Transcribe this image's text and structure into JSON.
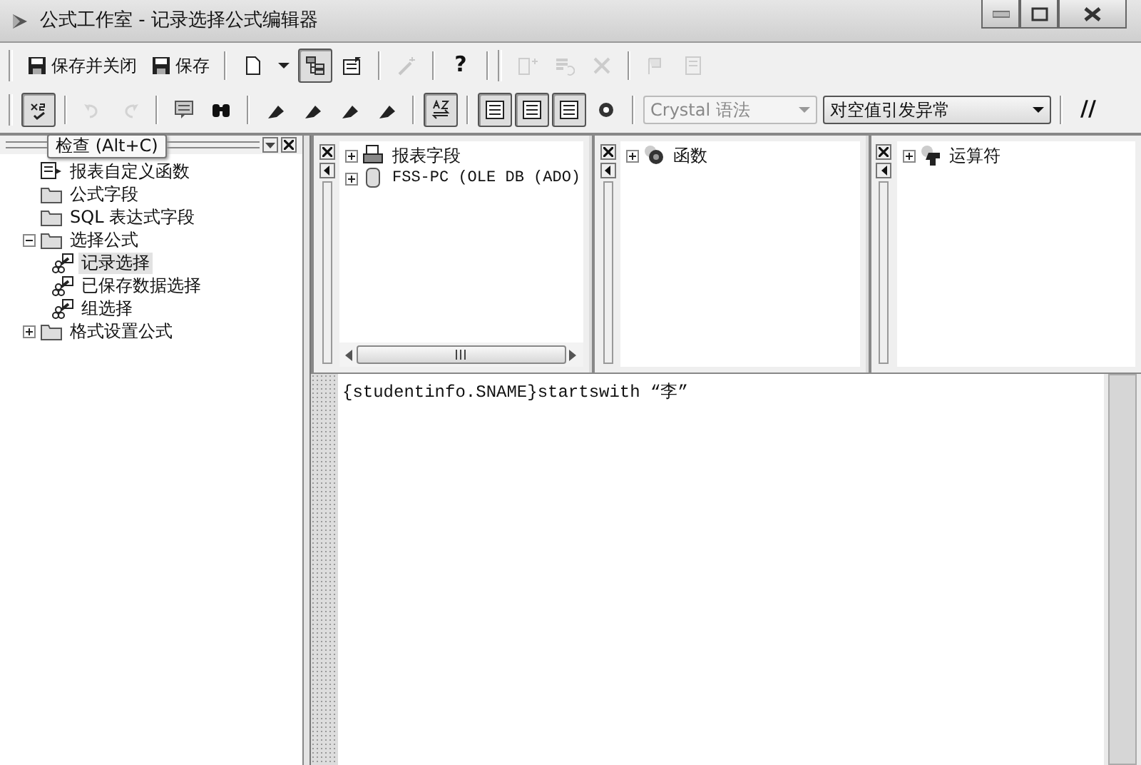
{
  "window": {
    "title": "公式工作室 - 记录选择公式编辑器"
  },
  "toolbar_1": {
    "groups": [
      [
        {
          "kind": "text",
          "label": "保存并关闭",
          "pressed": false,
          "disabled": false
        },
        {
          "kind": "text",
          "label": "保存",
          "pressed": false,
          "disabled": false
        }
      ],
      [
        {
          "kind": "icon",
          "pressed": false,
          "disabled": false
        },
        {
          "kind": "caret",
          "pressed": false,
          "disabled": false
        },
        {
          "kind": "icon",
          "pressed": true,
          "disabled": false
        },
        {
          "kind": "icon",
          "pressed": false,
          "disabled": false
        }
      ],
      [
        {
          "kind": "icon",
          "pressed": false,
          "disabled": true
        }
      ],
      [
        {
          "kind": "char",
          "label": "?",
          "pressed": false,
          "disabled": false
        }
      ],
      [
        {
          "kind": "icon",
          "pressed": false,
          "disabled": true
        },
        {
          "kind": "icon",
          "pressed": false,
          "disabled": true
        },
        {
          "kind": "icon",
          "pressed": false,
          "disabled": true
        }
      ],
      [
        {
          "kind": "icon",
          "pressed": false,
          "disabled": true
        },
        {
          "kind": "icon",
          "pressed": false,
          "disabled": true
        }
      ]
    ]
  },
  "toolbar_2": {
    "groups": [
      [
        {
          "kind": "icon",
          "pressed": true,
          "disabled": false
        }
      ],
      [
        {
          "kind": "icon",
          "pressed": false,
          "disabled": true
        },
        {
          "kind": "icon",
          "pressed": false,
          "disabled": true
        }
      ],
      [
        {
          "kind": "icon",
          "pressed": false,
          "disabled": false
        },
        {
          "kind": "icon",
          "pressed": false,
          "disabled": false
        }
      ],
      [
        {
          "kind": "icon",
          "pressed": false,
          "disabled": false
        },
        {
          "kind": "icon",
          "pressed": false,
          "disabled": false
        },
        {
          "kind": "icon",
          "pressed": false,
          "disabled": false
        },
        {
          "kind": "icon",
          "pressed": false,
          "disabled": false
        }
      ],
      [
        {
          "kind": "icon",
          "pressed": true,
          "disabled": false
        }
      ],
      [
        {
          "kind": "icon",
          "pressed": true,
          "disabled": false
        },
        {
          "kind": "icon",
          "pressed": true,
          "disabled": false
        },
        {
          "kind": "icon",
          "pressed": true,
          "disabled": false
        },
        {
          "kind": "icon",
          "pressed": false,
          "disabled": false
        }
      ],
      [
        {
          "kind": "combo",
          "label": "Crystal 语法",
          "disabled": true
        },
        {
          "kind": "combo",
          "label": "对空值引发异常",
          "disabled": false
        }
      ],
      [
        {
          "kind": "char",
          "label": "//",
          "pressed": false,
          "disabled": false
        }
      ]
    ]
  },
  "tooltip": "检查 (Alt+C)",
  "tree": [
    {
      "label": "报表自定义函数",
      "kind": "function",
      "selected": false
    },
    {
      "label": "公式字段",
      "kind": "folder",
      "selected": false
    },
    {
      "label": "SQL 表达式字段",
      "kind": "folder",
      "selected": false
    },
    {
      "label": "选择公式",
      "kind": "folder",
      "selected": false,
      "expanded": true,
      "children": [
        {
          "label": "记录选择",
          "kind": "formula",
          "selected": true
        },
        {
          "label": "已保存数据选择",
          "kind": "formula",
          "selected": false
        },
        {
          "label": "组选择",
          "kind": "formula",
          "selected": false
        }
      ]
    },
    {
      "label": "格式设置公式",
      "kind": "folder",
      "selected": false,
      "expanded": false
    }
  ],
  "panes": [
    {
      "items": [
        {
          "label": "报表字段",
          "kind": "report",
          "expanded": false
        },
        {
          "label": "FSS-PC (OLE DB (ADO)",
          "kind": "database",
          "expanded": false
        }
      ]
    },
    {
      "items": [
        {
          "label": "函数",
          "kind": "function",
          "expanded": false
        }
      ]
    },
    {
      "items": [
        {
          "label": "运算符",
          "kind": "operator",
          "expanded": false
        }
      ]
    }
  ],
  "editor": {
    "text": "{studentinfo.SNAME}startswith “李”"
  }
}
